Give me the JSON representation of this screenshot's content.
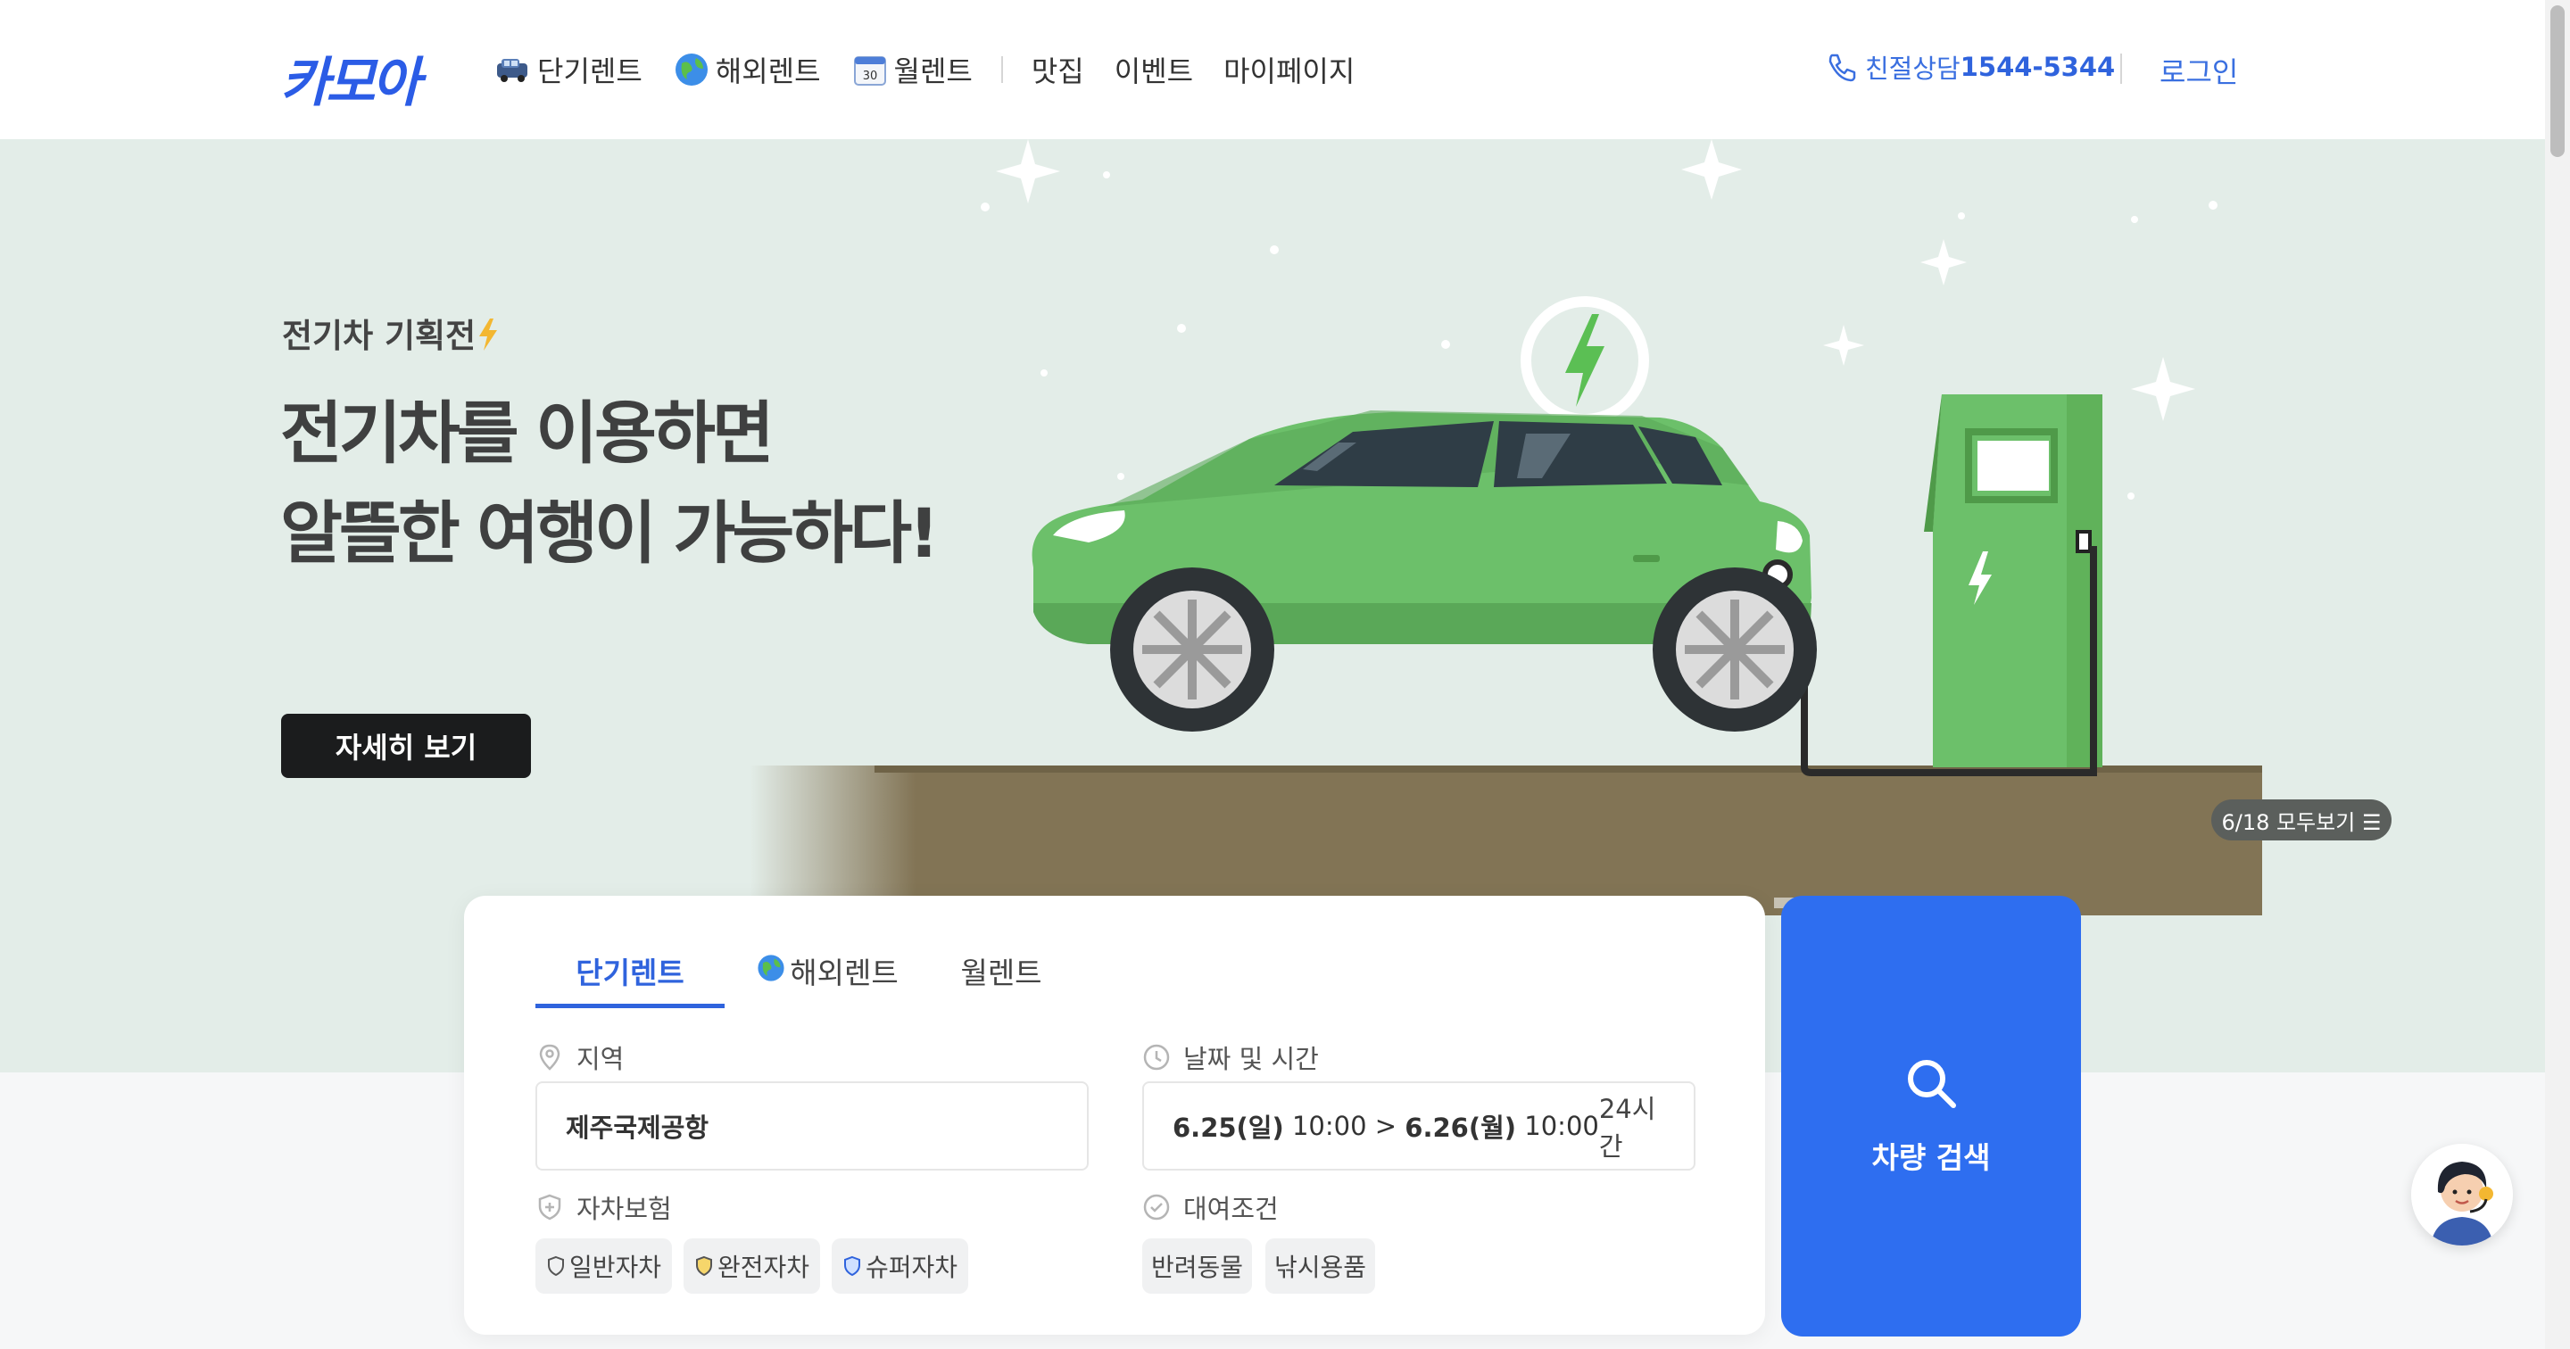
{
  "header": {
    "logo": "카모아",
    "nav": [
      {
        "label": "단기렌트",
        "icon": "car-icon"
      },
      {
        "label": "해외렌트",
        "icon": "globe-icon"
      },
      {
        "label": "월렌트",
        "icon": "calendar-icon",
        "calendar_day": "30"
      },
      {
        "label": "맛집"
      },
      {
        "label": "이벤트"
      },
      {
        "label": "마이페이지"
      }
    ],
    "phone_label": "친절상담",
    "phone_number": "1544-5344",
    "login": "로그인"
  },
  "hero": {
    "subtitle": "전기차 기획전",
    "title_line1": "전기차를 이용하면",
    "title_line2": "알뜰한 여행이 가능하다!",
    "cta": "자세히 보기",
    "page_indicator": "6/18 모두보기 ☰"
  },
  "search": {
    "tabs": [
      {
        "label": "단기렌트",
        "active": true
      },
      {
        "label": "해외렌트",
        "active": false
      },
      {
        "label": "월렌트",
        "active": false
      }
    ],
    "region_label": "지역",
    "region_value": "제주국제공항",
    "datetime_label": "날짜 및 시간",
    "date_from": "6.25(일)",
    "time_from": "10:00",
    "arrow": ">",
    "date_to": "6.26(월)",
    "time_to": "10:00",
    "duration": "24시간",
    "insurance_label": "자차보험",
    "insurance_options": [
      "일반자차",
      "완전자차",
      "슈퍼자차"
    ],
    "conditions_label": "대여조건",
    "condition_options": [
      "반려동물",
      "낚시용품"
    ],
    "search_button": "차량 검색"
  },
  "colors": {
    "brand": "#2e6ef0",
    "hero_bg": "#e3ede8",
    "car": "#6cc06a"
  }
}
